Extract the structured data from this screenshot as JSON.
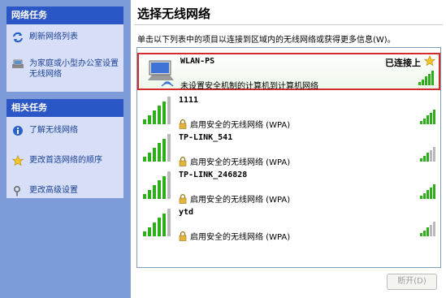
{
  "sidebar": {
    "network_tasks": {
      "header": "网络任务",
      "items": [
        {
          "label": "刷新网络列表",
          "icon": "refresh-icon"
        },
        {
          "label": "为家庭或小型办公室设置无线网络",
          "icon": "home-network-icon"
        }
      ]
    },
    "related_tasks": {
      "header": "相关任务",
      "items": [
        {
          "label": "了解无线网络",
          "icon": "info-icon"
        },
        {
          "label": "更改首选网络的顺序",
          "icon": "star-icon"
        },
        {
          "label": "更改高级设置",
          "icon": "settings-icon"
        }
      ]
    }
  },
  "main": {
    "title": "选择无线网络",
    "instruction": "单击以下列表中的项目以连接到区域内的无线网络或获得更多信息(W)。",
    "networks": [
      {
        "ssid": "WLAN-PS",
        "status": "已连接上",
        "description": "未设置安全机制的计算机到计算机网络",
        "secured": false,
        "signal": 5,
        "starred": true
      },
      {
        "ssid": "1111",
        "status": "",
        "description": "启用安全的无线网络 (WPA)",
        "secured": true,
        "signal": 5,
        "starred": false
      },
      {
        "ssid": "TP-LINK_541",
        "status": "",
        "description": "启用安全的无线网络 (WPA)",
        "secured": true,
        "signal": 3,
        "starred": false
      },
      {
        "ssid": "TP-LINK_246828",
        "status": "",
        "description": "启用安全的无线网络 (WPA)",
        "secured": true,
        "signal": 5,
        "starred": false
      },
      {
        "ssid": "ytd",
        "status": "",
        "description": "启用安全的无线网络 (WPA)",
        "secured": true,
        "signal": 3,
        "starred": false
      }
    ],
    "disconnect_label": "断开(D)"
  },
  "colors": {
    "sidebar_bg": "#7d9bd9",
    "panel_header": "#2b56c6",
    "panel_body": "#d6dff7",
    "link_text": "#1c3f94",
    "signal_on": "#2fae1c",
    "signal_off": "#b9b9b9",
    "selection_border": "#d12b2b"
  }
}
